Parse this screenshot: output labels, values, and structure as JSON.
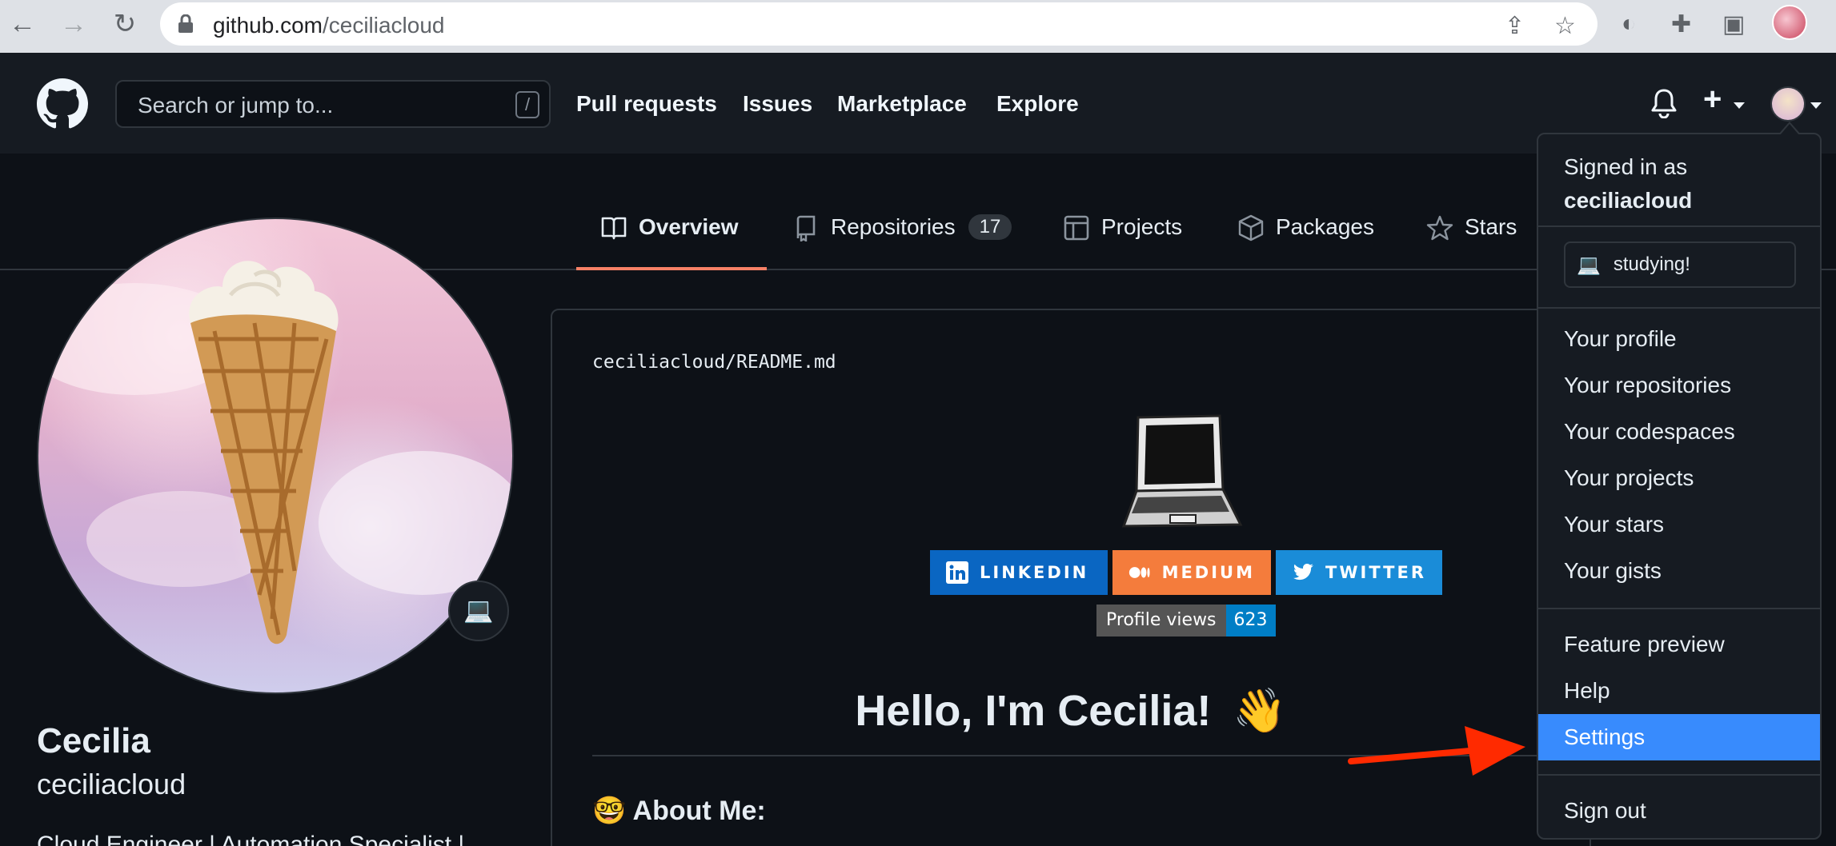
{
  "browser": {
    "url_host": "github.com",
    "url_path": "/ceciliacloud"
  },
  "header": {
    "search_placeholder": "Search or jump to...",
    "search_shortcut": "/",
    "nav": [
      "Pull requests",
      "Issues",
      "Marketplace",
      "Explore"
    ]
  },
  "tabs": [
    {
      "label": "Overview",
      "active": true,
      "icon": "book-icon"
    },
    {
      "label": "Repositories",
      "count": "17",
      "icon": "repo-icon"
    },
    {
      "label": "Projects",
      "icon": "table-icon"
    },
    {
      "label": "Packages",
      "icon": "package-icon"
    },
    {
      "label": "Stars",
      "icon": "star-icon"
    }
  ],
  "profile": {
    "name": "Cecilia",
    "login": "ceciliacloud",
    "bio": "Cloud Engineer | Automation Specialist |",
    "status_emoji": "💻"
  },
  "readme": {
    "owner": "ceciliacloud",
    "separator": "/",
    "file": "README.md",
    "badges": [
      {
        "label": "LINKEDIN",
        "color": "#0a66c2"
      },
      {
        "label": "MEDIUM",
        "color": "#f47c3c"
      },
      {
        "label": "TWITTER",
        "color": "#1a8cd8"
      }
    ],
    "views_label": "Profile views",
    "views_count": "623",
    "hello": "Hello, I'm Cecilia!",
    "hello_emoji": "👋",
    "about": "About Me:",
    "about_emoji": "🤓"
  },
  "dropdown": {
    "signed_in_as": "Signed in as",
    "username": "ceciliacloud",
    "status": "studying!",
    "status_emoji": "💻",
    "group1": [
      "Your profile",
      "Your repositories",
      "Your codespaces",
      "Your projects",
      "Your stars",
      "Your gists"
    ],
    "group2": [
      "Feature preview",
      "Help",
      "Settings"
    ],
    "highlighted": "Settings",
    "sign_out": "Sign out"
  },
  "colors": {
    "accent_tab": "#f78166",
    "highlight": "#388bfd",
    "arrow": "#ff2a00"
  }
}
